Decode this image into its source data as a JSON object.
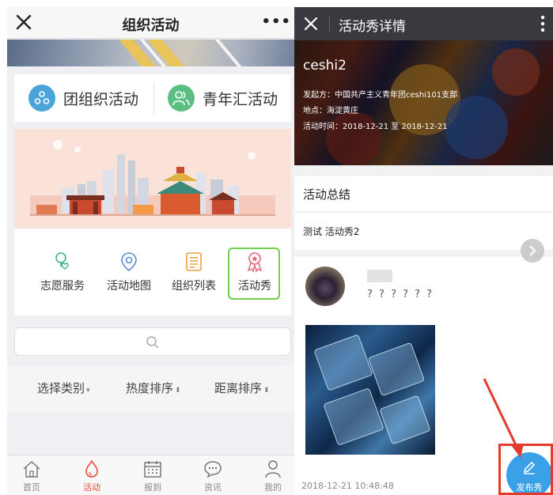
{
  "left": {
    "title": "组织活动",
    "more": "•••",
    "tabs": [
      {
        "label": "团组织活动",
        "icon": "org-group-icon",
        "color": "#4aa3d9"
      },
      {
        "label": "青年汇活动",
        "icon": "youth-people-icon",
        "color": "#5bbf82"
      }
    ],
    "services": [
      {
        "label": "志愿服务",
        "icon": "volunteer-heart-icon"
      },
      {
        "label": "活动地图",
        "icon": "map-pin-icon"
      },
      {
        "label": "组织列表",
        "icon": "list-document-icon"
      },
      {
        "label": "活动秀",
        "icon": "award-ribbon-icon"
      }
    ],
    "filters": [
      {
        "label": "选择类别",
        "arrow": "▾"
      },
      {
        "label": "热度排序",
        "arrow": "⬍"
      },
      {
        "label": "距离排序",
        "arrow": "⬍"
      }
    ],
    "bottom_nav": [
      {
        "label": "首页",
        "icon": "home-icon"
      },
      {
        "label": "活动",
        "icon": "fire-drop-icon"
      },
      {
        "label": "报到",
        "icon": "calendar-icon"
      },
      {
        "label": "资讯",
        "icon": "chat-bubble-icon"
      },
      {
        "label": "我的",
        "icon": "person-icon"
      }
    ],
    "active_tab_color": "#e94b3c",
    "highlight_color": "#6cd04a"
  },
  "right": {
    "title": "活动秀详情",
    "hero": {
      "name": "ceshi2",
      "sponsor": "发起方：中国共产主义青年团ceshi101支部",
      "location": "地点：海淀黄庄",
      "time": "活动时间：2018-12-21 至 2018-12-21"
    },
    "summary_title": "活动总结",
    "summary_text": "测试 活动秀2",
    "post": {
      "comment": "? ? ? ? ? ?",
      "timestamp": "2018-12-21 10:48:48"
    },
    "fab_label": "发布秀",
    "accent_color": "#3aa0e8",
    "annotation_color": "#e53a2e"
  }
}
